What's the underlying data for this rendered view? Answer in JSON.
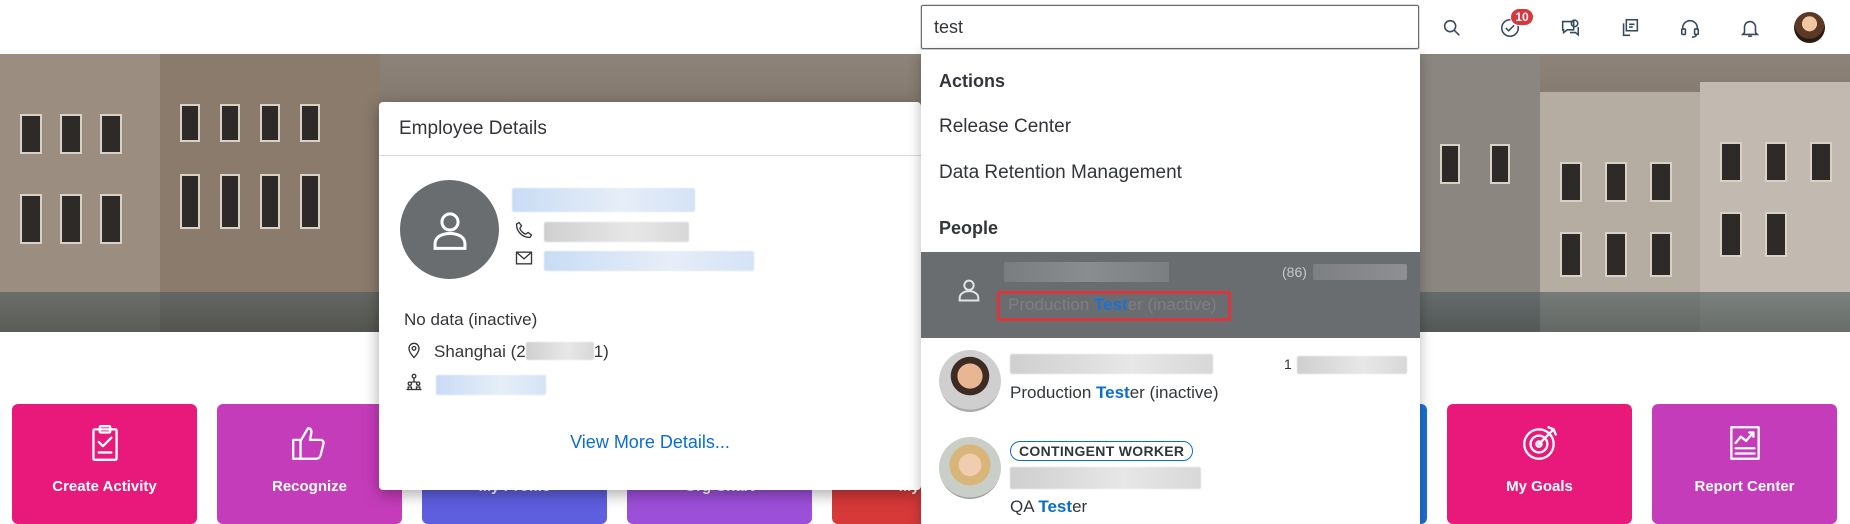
{
  "search": {
    "value": "test",
    "placeholder": ""
  },
  "shell": {
    "tasks_badge": "10",
    "icons": [
      "search-icon",
      "tasks-icon",
      "feedback-icon",
      "notes-icon",
      "headset-icon",
      "bell-icon"
    ]
  },
  "tiles": [
    {
      "label": "Create Activity",
      "icon": "clipboard-check-icon",
      "color": "#e8197a"
    },
    {
      "label": "Recognize",
      "icon": "thumbs-up-icon",
      "color": "#c53cba"
    },
    {
      "label": "My Profile",
      "icon": "",
      "color": "#5d5fdf"
    },
    {
      "label": "Org Chart",
      "icon": "",
      "color": "#9c4fd8"
    },
    {
      "label": "My Tim",
      "icon": "",
      "color": "#d73939"
    },
    {
      "label": "My Goals",
      "icon": "target-icon",
      "color": "#e8197a"
    },
    {
      "label": "Report Center",
      "icon": "report-icon",
      "color": "#c53cba"
    }
  ],
  "employee_card": {
    "title": "Employee Details",
    "status": "No data (inactive)",
    "location_prefix": "Shanghai (2",
    "location_suffix": "1)",
    "view_more": "View More Details..."
  },
  "suggestions": {
    "actions_title": "Actions",
    "actions": [
      "Release Center",
      "Data Retention Management"
    ],
    "people_title": "People",
    "people": [
      {
        "prefix": "Production ",
        "match": "Test",
        "suffix": "er (inactive)",
        "meta": "(86)",
        "highlighted": true
      },
      {
        "prefix": "Production ",
        "match": "Test",
        "suffix": "er (inactive)",
        "meta": "1",
        "highlighted": false
      },
      {
        "prefix": "QA ",
        "match": "Test",
        "suffix": "er",
        "badge": "CONTINGENT WORKER",
        "highlighted": false
      }
    ]
  },
  "colors": {
    "accent": "#0a6ed1",
    "highlight_row": "#6a6d70",
    "badge_red": "#d9363e"
  }
}
